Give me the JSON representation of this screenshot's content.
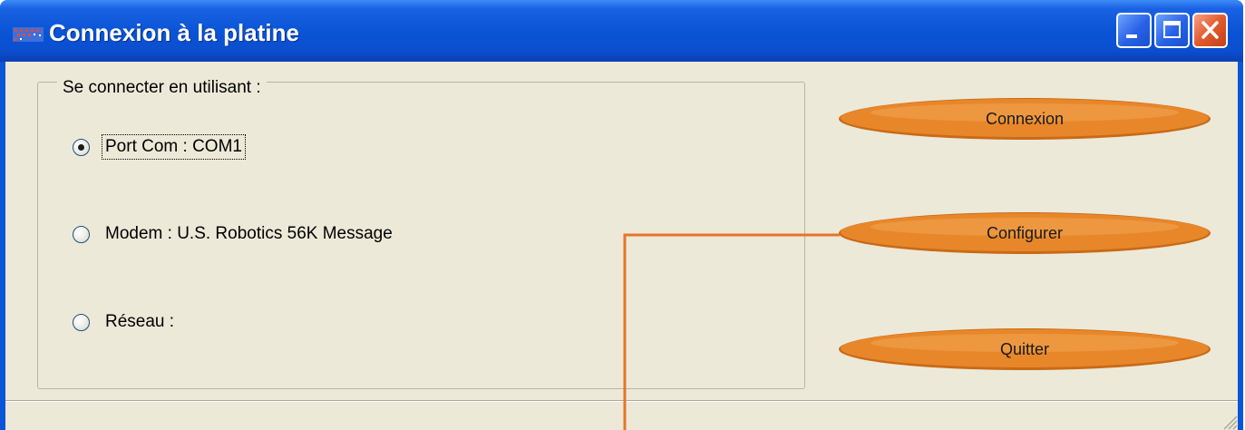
{
  "window": {
    "title": "Connexion à la platine",
    "icon": "app-icon",
    "controls": [
      "minimize-icon",
      "maximize-icon",
      "close-icon"
    ]
  },
  "connection_group": {
    "legend": "Se connecter en utilisant :",
    "options": [
      {
        "label": "Port Com : COM1",
        "selected": true
      },
      {
        "label": "Modem : U.S. Robotics 56K Message",
        "selected": false
      },
      {
        "label": "Réseau :",
        "selected": false
      }
    ]
  },
  "actions": {
    "connect_label": "Connexion",
    "configure_label": "Configurer",
    "quit_label": "Quitter"
  },
  "colors": {
    "title_bar": "#0a54d6",
    "client_background": "#ece9d8",
    "button_orange": "#e8872a",
    "callout_line": "#e8742a"
  }
}
